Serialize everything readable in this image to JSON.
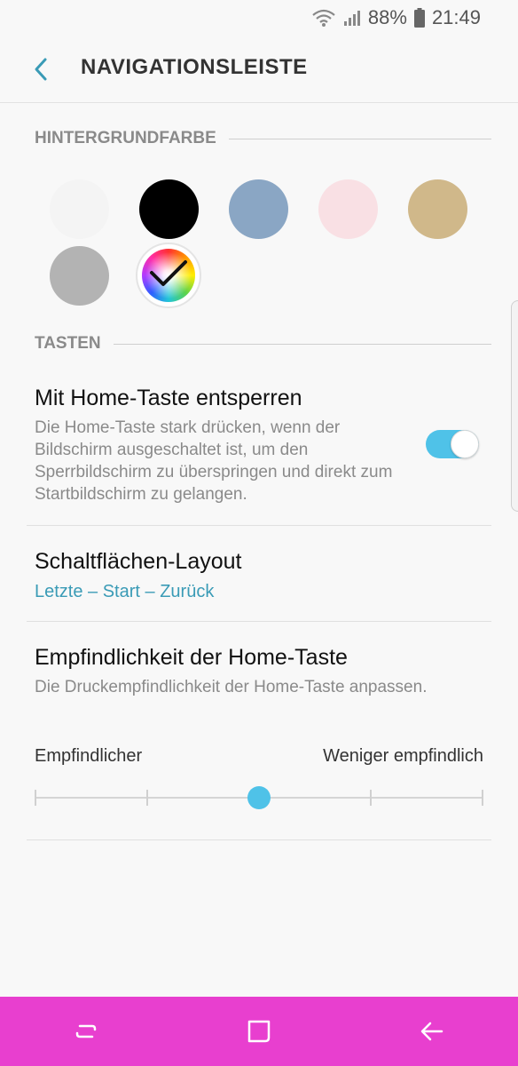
{
  "status_bar": {
    "battery": "88%",
    "time": "21:49",
    "icons": [
      "wifi-icon",
      "signal-icon",
      "battery-icon"
    ]
  },
  "header": {
    "title": "NAVIGATIONSLEISTE",
    "back_icon": "back-arrow-icon"
  },
  "background_color": {
    "heading": "HINTERGRUNDFARBE",
    "swatches": [
      {
        "name": "white",
        "color": "#f4f4f4"
      },
      {
        "name": "black",
        "color": "#000000"
      },
      {
        "name": "blue-gray",
        "color": "#8aa6c4"
      },
      {
        "name": "pink",
        "color": "#f9e0e4"
      },
      {
        "name": "gold",
        "color": "#d0b88a"
      },
      {
        "name": "gray",
        "color": "#b3b3b3"
      },
      {
        "name": "custom-color-wheel",
        "selected": true
      }
    ]
  },
  "keys": {
    "heading": "TASTEN",
    "home_unlock": {
      "title": "Mit Home-Taste entsperren",
      "description": "Die Home-Taste stark drücken, wenn der Bildschirm ausgeschaltet ist, um den Sperrbildschirm zu überspringen und direkt zum Startbildschirm zu gelangen.",
      "enabled": true
    },
    "button_layout": {
      "title": "Schaltflächen-Layout",
      "value": "Letzte – Start – Zurück"
    },
    "sensitivity": {
      "title": "Empfindlichkeit der Home-Taste",
      "description": "Die Druckempfindlichkeit der Home-Taste anpassen.",
      "min_label": "Empfindlicher",
      "max_label": "Weniger empfindlich",
      "steps": 5,
      "value_index": 2
    }
  },
  "navbar": {
    "background": "#e83fcf",
    "buttons": [
      "recents-icon",
      "home-icon",
      "back-icon"
    ]
  },
  "colors": {
    "accent": "#4fc2e8",
    "link": "#3a9bb6"
  }
}
